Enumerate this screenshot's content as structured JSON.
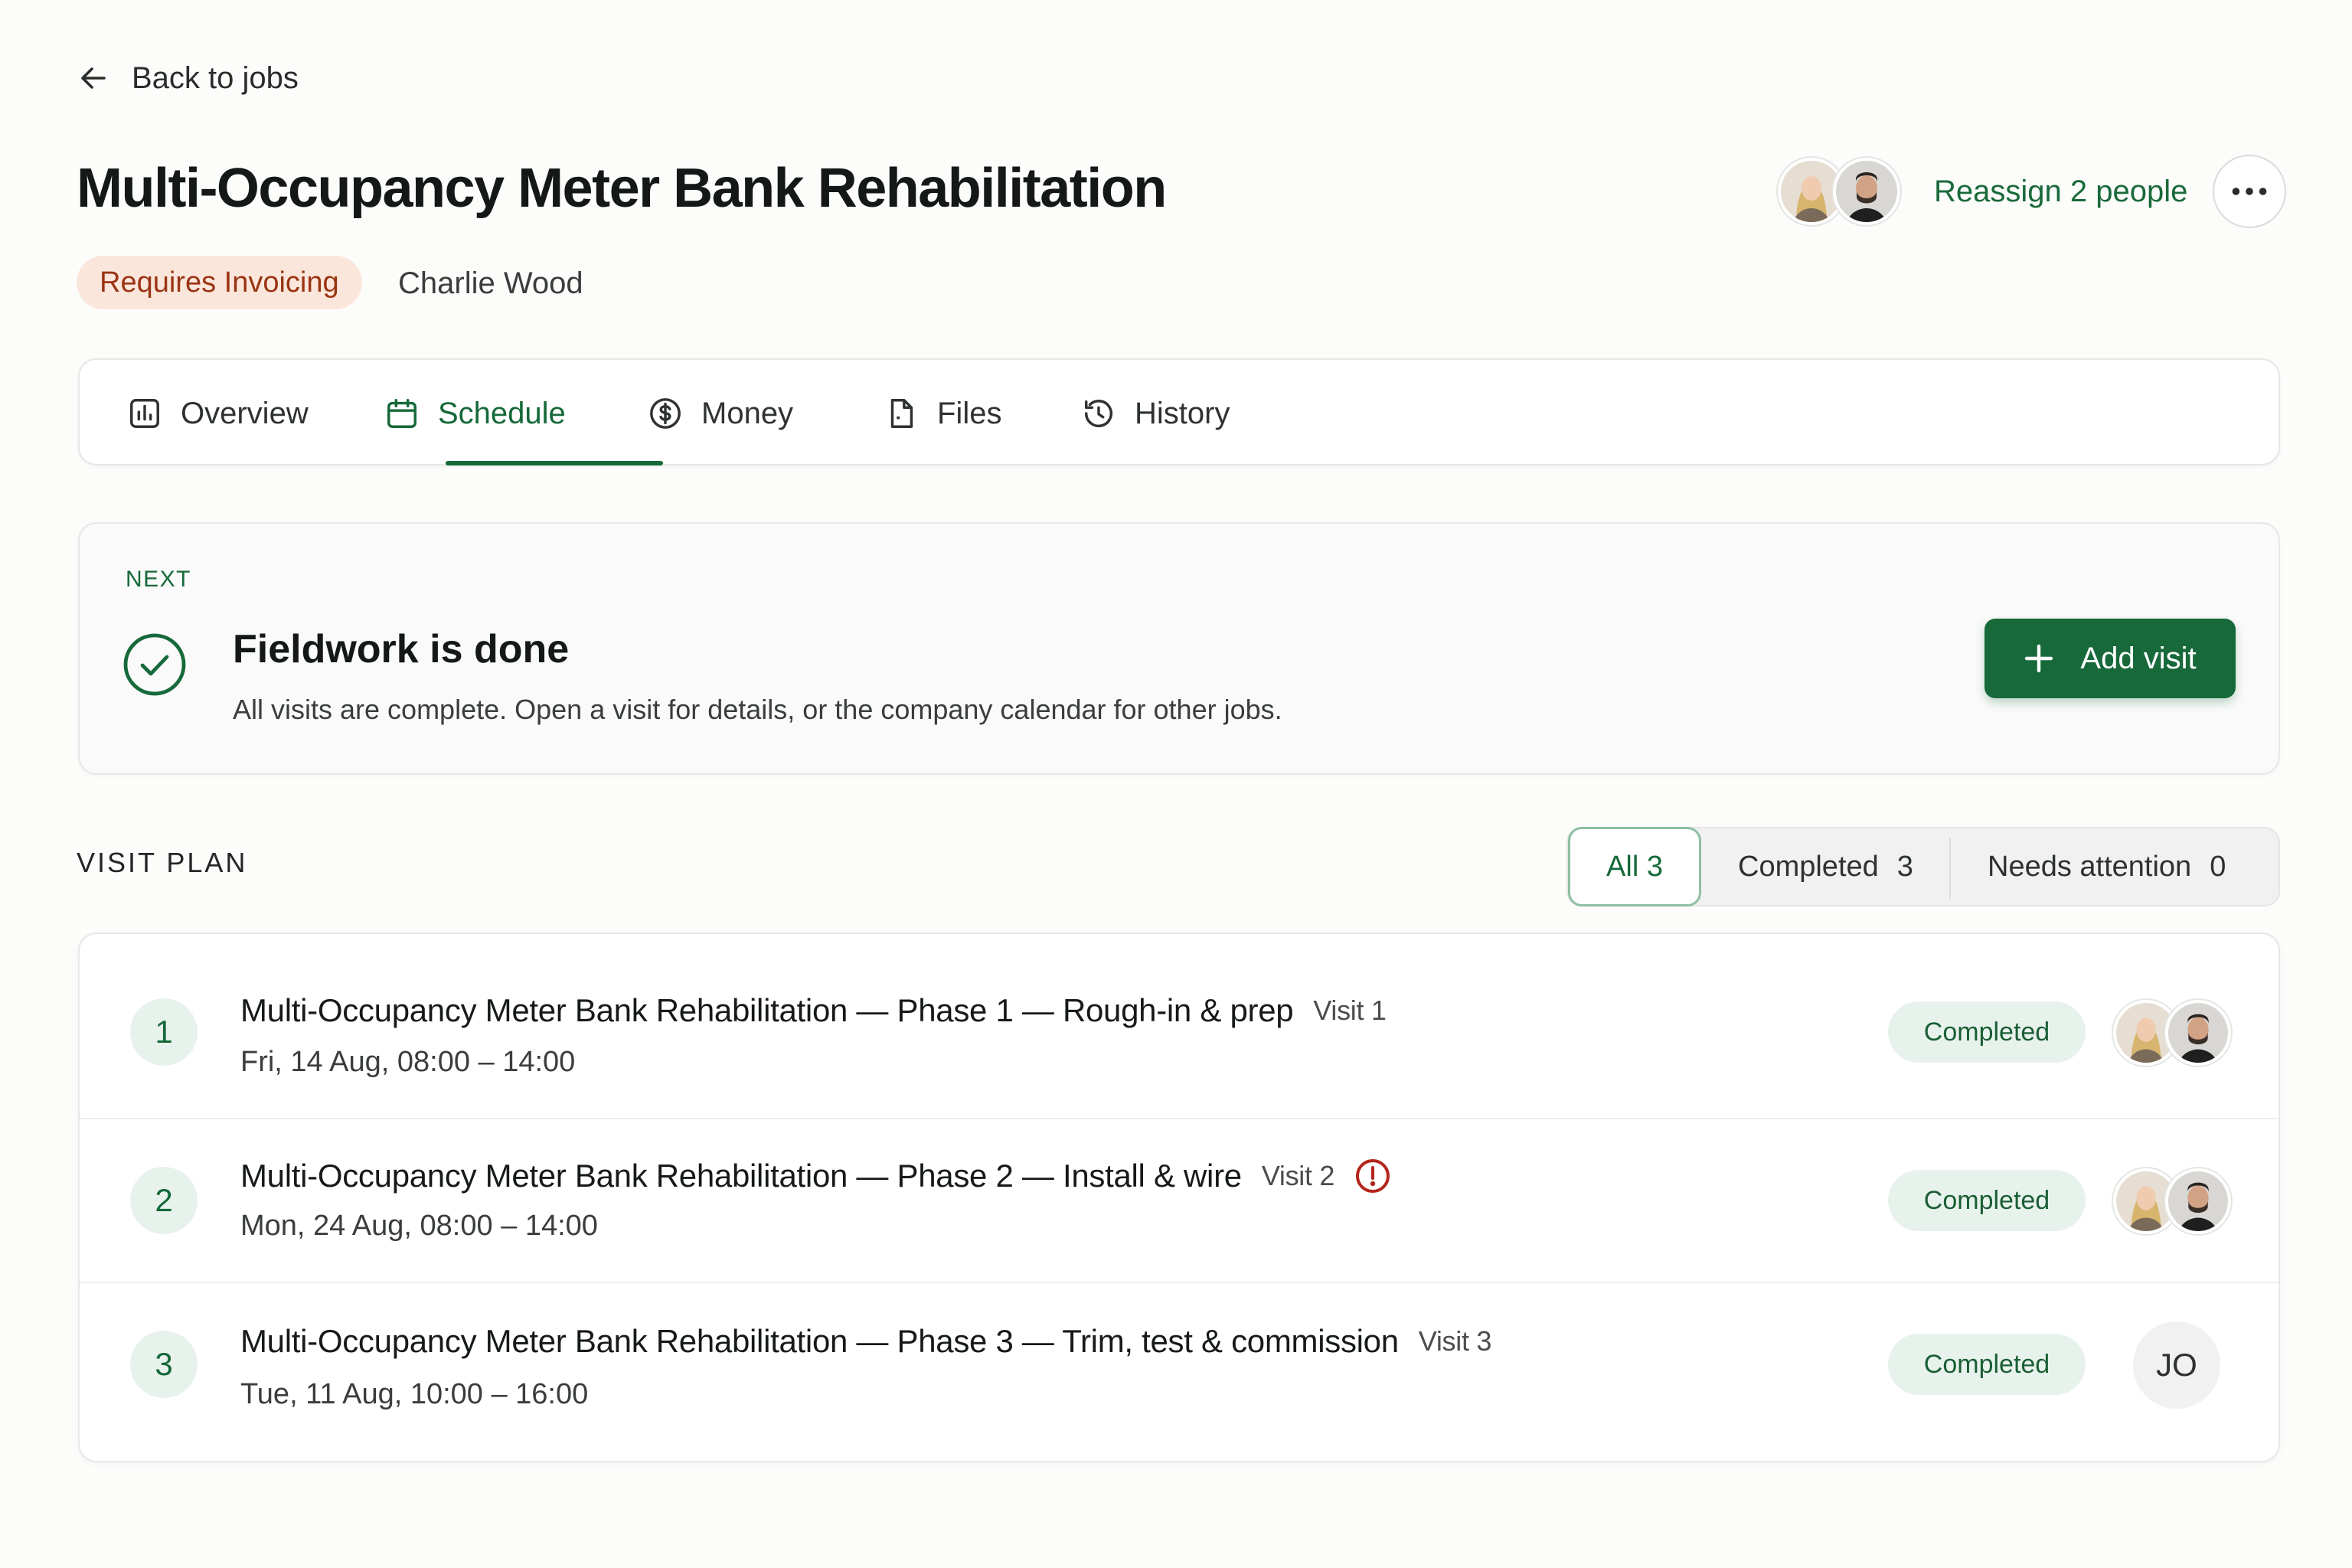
{
  "nav": {
    "back_label": "Back to jobs"
  },
  "job": {
    "title": "Multi-Occupancy Meter Bank Rehabilitation",
    "status_badge": "Requires Invoicing",
    "owner": "Charlie Wood"
  },
  "assignees": {
    "reassign_label": "Reassign 2 people"
  },
  "tabs": [
    {
      "label": "Overview",
      "icon": "chart-icon",
      "active": false
    },
    {
      "label": "Schedule",
      "icon": "calendar-icon",
      "active": true
    },
    {
      "label": "Money",
      "icon": "dollar-icon",
      "active": false
    },
    {
      "label": "Files",
      "icon": "file-icon",
      "active": false
    },
    {
      "label": "History",
      "icon": "history-icon",
      "active": false
    }
  ],
  "next": {
    "label": "NEXT",
    "title": "Fieldwork is done",
    "description": "All visits are complete. Open a visit for details, or the company calendar for other jobs.",
    "add_visit_label": "Add visit"
  },
  "visit_plan": {
    "label": "VISIT PLAN",
    "filters": [
      {
        "label": "All",
        "count": "3",
        "active": true
      },
      {
        "label": "Completed",
        "count": "3",
        "active": false
      },
      {
        "label": "Needs attention",
        "count": "0",
        "active": false
      }
    ],
    "visits": [
      {
        "number": "1",
        "title": "Multi-Occupancy Meter Bank Rehabilitation — Phase 1 — Rough-in & prep",
        "visit_label": "Visit 1",
        "date": "Fri, 14 Aug, 08:00 – 14:00",
        "status": "Completed",
        "warning": false
      },
      {
        "number": "2",
        "title": "Multi-Occupancy Meter Bank Rehabilitation — Phase 2 — Install & wire",
        "visit_label": "Visit 2",
        "date": "Mon, 24 Aug, 08:00 – 14:00",
        "status": "Completed",
        "warning": true
      },
      {
        "number": "3",
        "title": "Multi-Occupancy Meter Bank Rehabilitation — Phase 3 — Trim, test & commission",
        "visit_label": "Visit 3",
        "date": "Tue, 11 Aug, 10:00 – 16:00",
        "status": "Completed",
        "warning": false,
        "assignee_initials": "JO"
      }
    ]
  },
  "colors": {
    "accent": "#16693a",
    "badge_bg": "#fbe6dc",
    "badge_text": "#9a3412",
    "warning": "#b3261e"
  }
}
